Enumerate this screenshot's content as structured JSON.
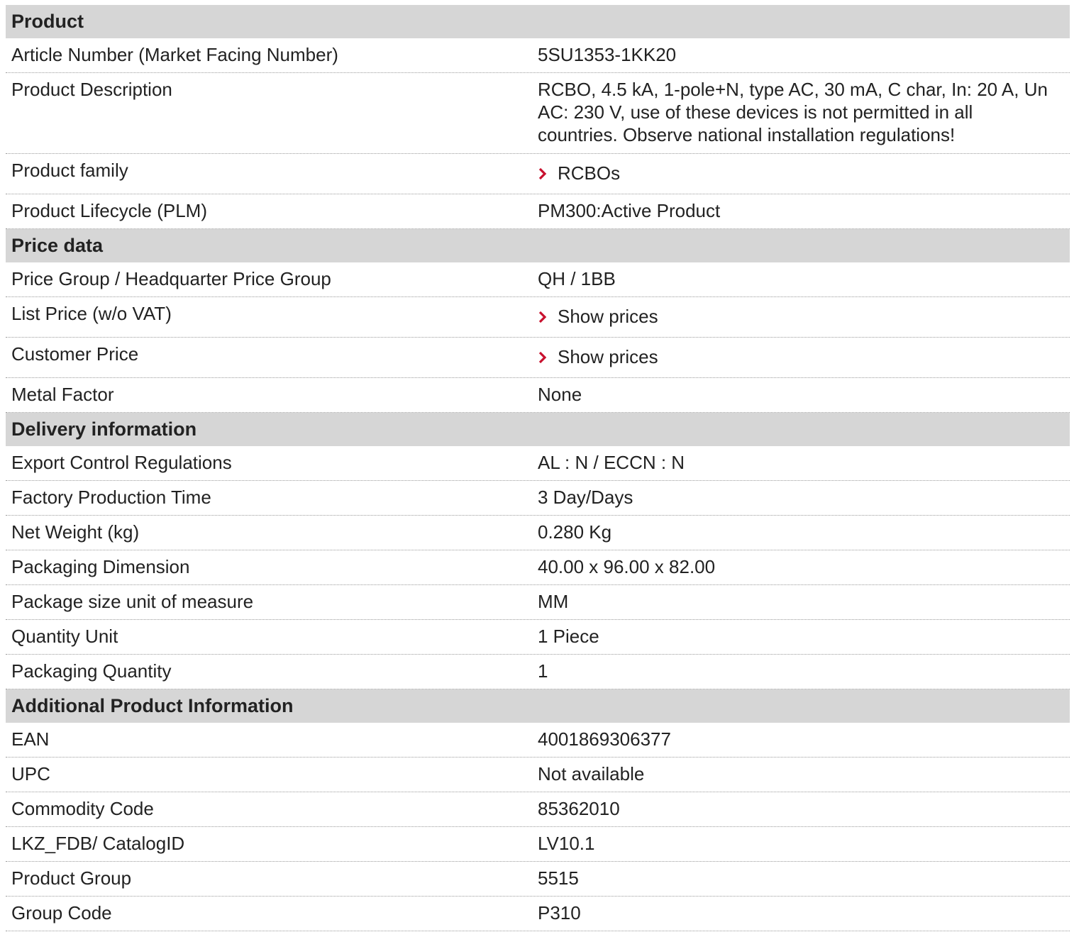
{
  "sections": [
    {
      "title": "Product",
      "rows": [
        {
          "label": "Article Number (Market Facing Number)",
          "value": "5SU1353-1KK20"
        },
        {
          "label": "Product Description",
          "value": "RCBO, 4.5 kA, 1-pole+N, type AC, 30 mA, C char, In: 20 A, Un AC: 230 V, use of these devices is not permitted in all countries. Observe national installation regulations!"
        },
        {
          "label": "Product family",
          "value": "RCBOs"
        },
        {
          "label": "Product Lifecycle (PLM)",
          "value": "PM300:Active Product"
        }
      ]
    },
    {
      "title": "Price data",
      "rows": [
        {
          "label": "Price Group / Headquarter Price Group",
          "value": "QH / 1BB"
        },
        {
          "label": "List Price (w/o VAT)",
          "value": "Show prices"
        },
        {
          "label": "Customer Price",
          "value": "Show prices"
        },
        {
          "label": "Metal Factor",
          "value": "None"
        }
      ]
    },
    {
      "title": "Delivery information",
      "rows": [
        {
          "label": "Export Control Regulations",
          "value": "AL : N / ECCN : N"
        },
        {
          "label": "Factory Production Time",
          "value": "3 Day/Days"
        },
        {
          "label": "Net Weight (kg)",
          "value": "0.280 Kg"
        },
        {
          "label": "Packaging Dimension",
          "value": "40.00 x 96.00 x 82.00"
        },
        {
          "label": "Package size unit of measure",
          "value": "MM"
        },
        {
          "label": "Quantity Unit",
          "value": "1 Piece"
        },
        {
          "label": "Packaging Quantity",
          "value": "1"
        }
      ]
    },
    {
      "title": "Additional Product Information",
      "rows": [
        {
          "label": "EAN",
          "value": "4001869306377"
        },
        {
          "label": "UPC",
          "value": "Not available"
        },
        {
          "label": "Commodity Code",
          "value": "85362010"
        },
        {
          "label": "LKZ_FDB/ CatalogID",
          "value": "LV10.1"
        },
        {
          "label": "Product Group",
          "value": "5515"
        },
        {
          "label": "Group Code",
          "value": "P310"
        }
      ]
    }
  ],
  "colors": {
    "section_bg": "#d6d6d6",
    "link_chevron": "#c8102e",
    "text": "#222222"
  },
  "icons": {
    "link_marker": "chevron-right-icon"
  }
}
